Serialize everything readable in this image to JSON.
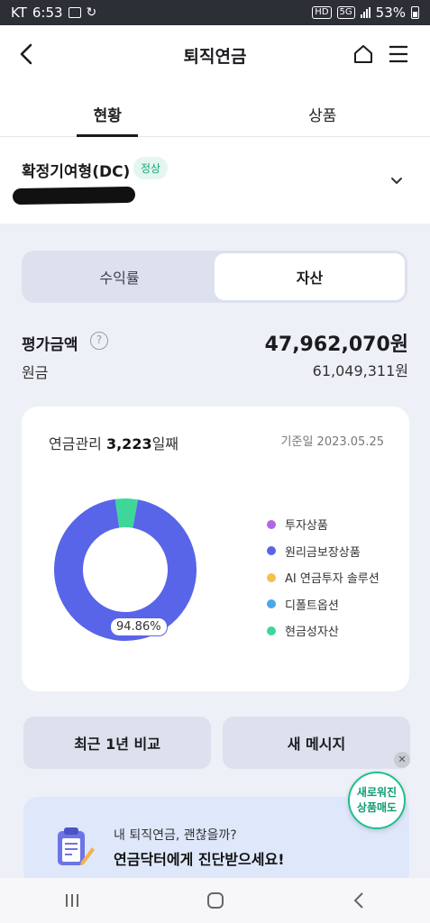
{
  "status_bar": {
    "carrier": "KT",
    "time": "6:53",
    "network": "5G",
    "battery": "53%"
  },
  "header": {
    "title": "퇴직연금"
  },
  "tabs": [
    {
      "label": "현황",
      "active": true
    },
    {
      "label": "상품",
      "active": false
    }
  ],
  "plan": {
    "name": "확정기여형(DC)",
    "badge": "정상"
  },
  "segment": [
    {
      "label": "수익률",
      "active": false
    },
    {
      "label": "자산",
      "active": true
    }
  ],
  "summary": {
    "eval_label": "평가금액",
    "eval_value": "47,962,070원",
    "principal_label": "원금",
    "principal_value": "61,049,311원"
  },
  "card": {
    "days_prefix": "연금관리 ",
    "days_count": "3,223",
    "days_suffix": "일째",
    "as_of": "기준일 2023.05.25",
    "donut_label": "94.86%",
    "legend": [
      {
        "label": "투자상품",
        "color": "#b266e3"
      },
      {
        "label": "원리금보장상품",
        "color": "#5865e8"
      },
      {
        "label": "AI 연금투자 솔루션",
        "color": "#f2c14e"
      },
      {
        "label": "디폴트옵션",
        "color": "#4aa8e8"
      },
      {
        "label": "현금성자산",
        "color": "#3fd69a"
      }
    ],
    "slices": [
      {
        "name": "원리금보장상품",
        "value": 94.86,
        "color": "#5865e8"
      },
      {
        "name": "현금성자산",
        "value": 5.14,
        "color": "#3fd69a"
      }
    ]
  },
  "buttons": {
    "compare": "최근 1년 비교",
    "messages": "새 메시지"
  },
  "floating": {
    "close": "✕",
    "line1": "새로워진",
    "line2": "상품매도"
  },
  "banner": {
    "subtitle": "내 퇴직연금, 괜찮을까?",
    "title": "연금닥터에게 진단받으세요!"
  }
}
